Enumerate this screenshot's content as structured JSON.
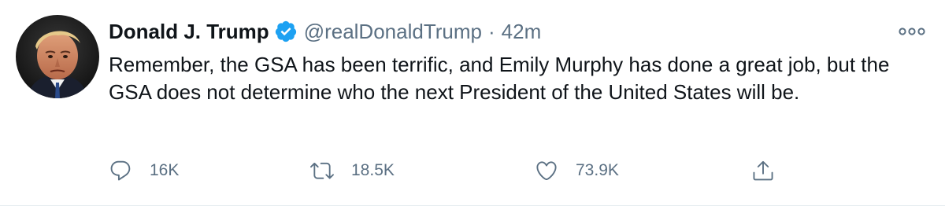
{
  "tweet": {
    "author": {
      "display_name": "Donald J. Trump",
      "handle": "@realDonaldTrump",
      "verified": true
    },
    "separator": "·",
    "timestamp": "42m",
    "text": "Remember, the GSA has been terrific, and Emily Murphy has done a great job, but the GSA does not determine who the next President of the United States will be.",
    "actions": {
      "reply_count": "16K",
      "retweet_count": "18.5K",
      "like_count": "73.9K"
    },
    "icons": [
      "avatar",
      "verified-badge-icon",
      "more-options-icon",
      "reply-icon",
      "retweet-icon",
      "like-icon",
      "share-icon"
    ],
    "colors": {
      "verified_blue": "#1da1f2",
      "secondary_text": "#5b7083",
      "primary_text": "#0f1419"
    }
  }
}
